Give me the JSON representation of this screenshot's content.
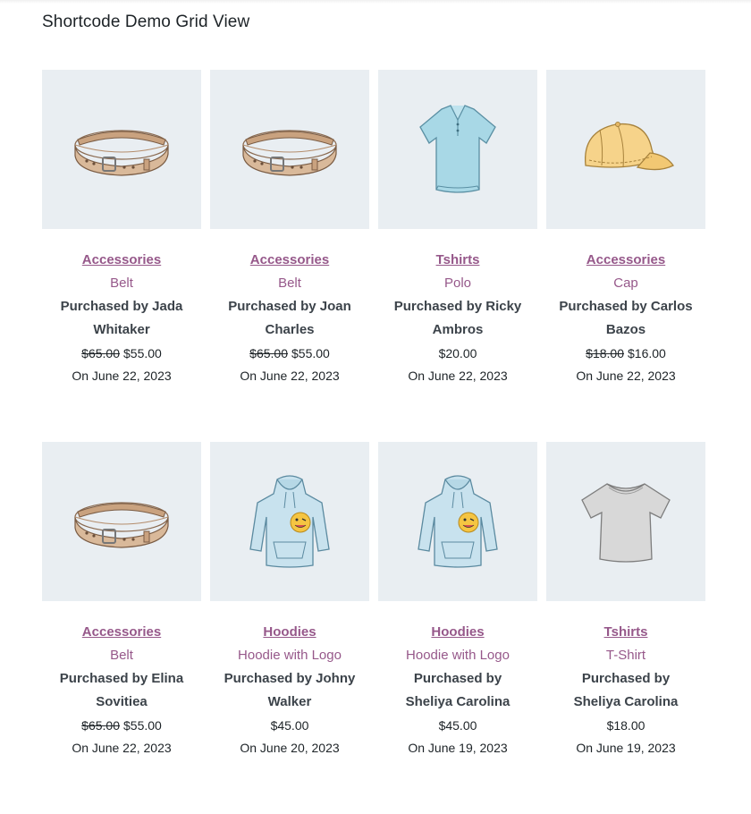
{
  "heading": "Shortcode Demo Grid View",
  "colors": {
    "link": "#96588a",
    "thumb_bg": "#e9eef2",
    "text": "#3c434a"
  },
  "products": [
    {
      "category": "Accessories",
      "name": "Belt",
      "buyer": "Purchased by Jada Whitaker",
      "old_price": "$65.00",
      "price": "$55.00",
      "date": "On June 22, 2023",
      "image": "belt"
    },
    {
      "category": "Accessories",
      "name": "Belt",
      "buyer": "Purchased by Joan Charles",
      "old_price": "$65.00",
      "price": "$55.00",
      "date": "On June 22, 2023",
      "image": "belt"
    },
    {
      "category": "Tshirts",
      "name": "Polo",
      "buyer": "Purchased by Ricky Ambros",
      "old_price": "",
      "price": "$20.00",
      "date": "On June 22, 2023",
      "image": "polo"
    },
    {
      "category": "Accessories",
      "name": "Cap",
      "buyer": "Purchased by Carlos Bazos",
      "old_price": "$18.00",
      "price": "$16.00",
      "date": "On June 22, 2023",
      "image": "cap"
    },
    {
      "category": "Accessories",
      "name": "Belt",
      "buyer": "Purchased by Elina Sovitiea",
      "old_price": "$65.00",
      "price": "$55.00",
      "date": "On June 22, 2023",
      "image": "belt"
    },
    {
      "category": "Hoodies",
      "name": "Hoodie with Logo",
      "buyer": "Purchased by Johny Walker",
      "old_price": "",
      "price": "$45.00",
      "date": "On June 20, 2023",
      "image": "hoodie"
    },
    {
      "category": "Hoodies",
      "name": "Hoodie with Logo",
      "buyer": "Purchased by Sheliya Carolina",
      "old_price": "",
      "price": "$45.00",
      "date": "On June 19, 2023",
      "image": "hoodie"
    },
    {
      "category": "Tshirts",
      "name": "T-Shirt",
      "buyer": "Purchased by Sheliya Carolina",
      "old_price": "",
      "price": "$18.00",
      "date": "On June 19, 2023",
      "image": "tshirt"
    }
  ]
}
